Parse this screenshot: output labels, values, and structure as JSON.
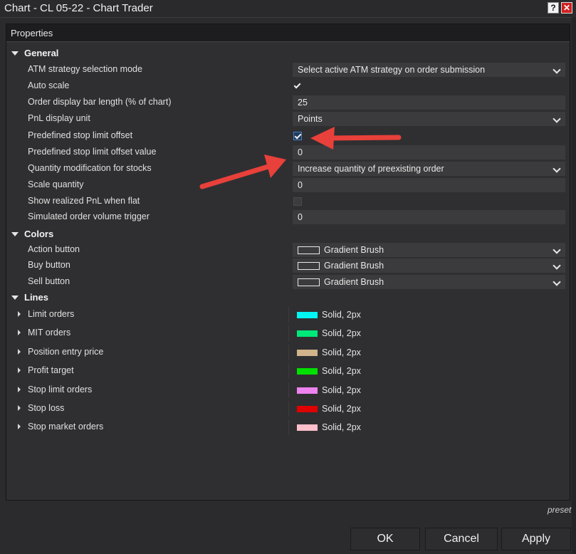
{
  "window": {
    "title": "Chart - CL 05-22 - Chart Trader",
    "help_label": "?",
    "close_label": "✕"
  },
  "properties": {
    "header": "Properties"
  },
  "general": {
    "label": "General",
    "atm_mode": {
      "label": "ATM strategy selection mode",
      "value": "Select active ATM strategy on order submission"
    },
    "auto_scale": {
      "label": "Auto scale",
      "checked": true
    },
    "bar_length": {
      "label": "Order display bar length (% of chart)",
      "value": "25"
    },
    "pnl_unit": {
      "label": "PnL display unit",
      "value": "Points"
    },
    "stop_limit_offset": {
      "label": "Predefined stop limit offset",
      "checked": true
    },
    "stop_limit_offset_value": {
      "label": "Predefined stop limit offset value",
      "value": "0"
    },
    "qty_mod": {
      "label": "Quantity modification for stocks",
      "value": "Increase quantity of preexisting order"
    },
    "scale_qty": {
      "label": "Scale quantity",
      "value": "0"
    },
    "show_pnl_flat": {
      "label": "Show realized PnL when flat",
      "checked": false
    },
    "sim_volume": {
      "label": "Simulated order volume trigger",
      "value": "0"
    }
  },
  "colors": {
    "label": "Colors",
    "action": {
      "label": "Action button",
      "value": "Gradient Brush"
    },
    "buy": {
      "label": "Buy button",
      "value": "Gradient Brush"
    },
    "sell": {
      "label": "Sell button",
      "value": "Gradient Brush"
    }
  },
  "lines": {
    "label": "Lines",
    "items": [
      {
        "label": "Limit orders",
        "value": "Solid, 2px",
        "color": "#00f5f5"
      },
      {
        "label": "MIT orders",
        "value": "Solid, 2px",
        "color": "#00e87a"
      },
      {
        "label": "Position entry price",
        "value": "Solid, 2px",
        "color": "#d2b48c"
      },
      {
        "label": "Profit target",
        "value": "Solid, 2px",
        "color": "#00e000"
      },
      {
        "label": "Stop limit orders",
        "value": "Solid, 2px",
        "color": "#ee82ee"
      },
      {
        "label": "Stop loss",
        "value": "Solid, 2px",
        "color": "#e00000"
      },
      {
        "label": "Stop market orders",
        "value": "Solid, 2px",
        "color": "#ffc0cb"
      }
    ]
  },
  "footer": {
    "preset": "preset",
    "ok": "OK",
    "cancel": "Cancel",
    "apply": "Apply"
  },
  "annotation_color": "#e8403a"
}
